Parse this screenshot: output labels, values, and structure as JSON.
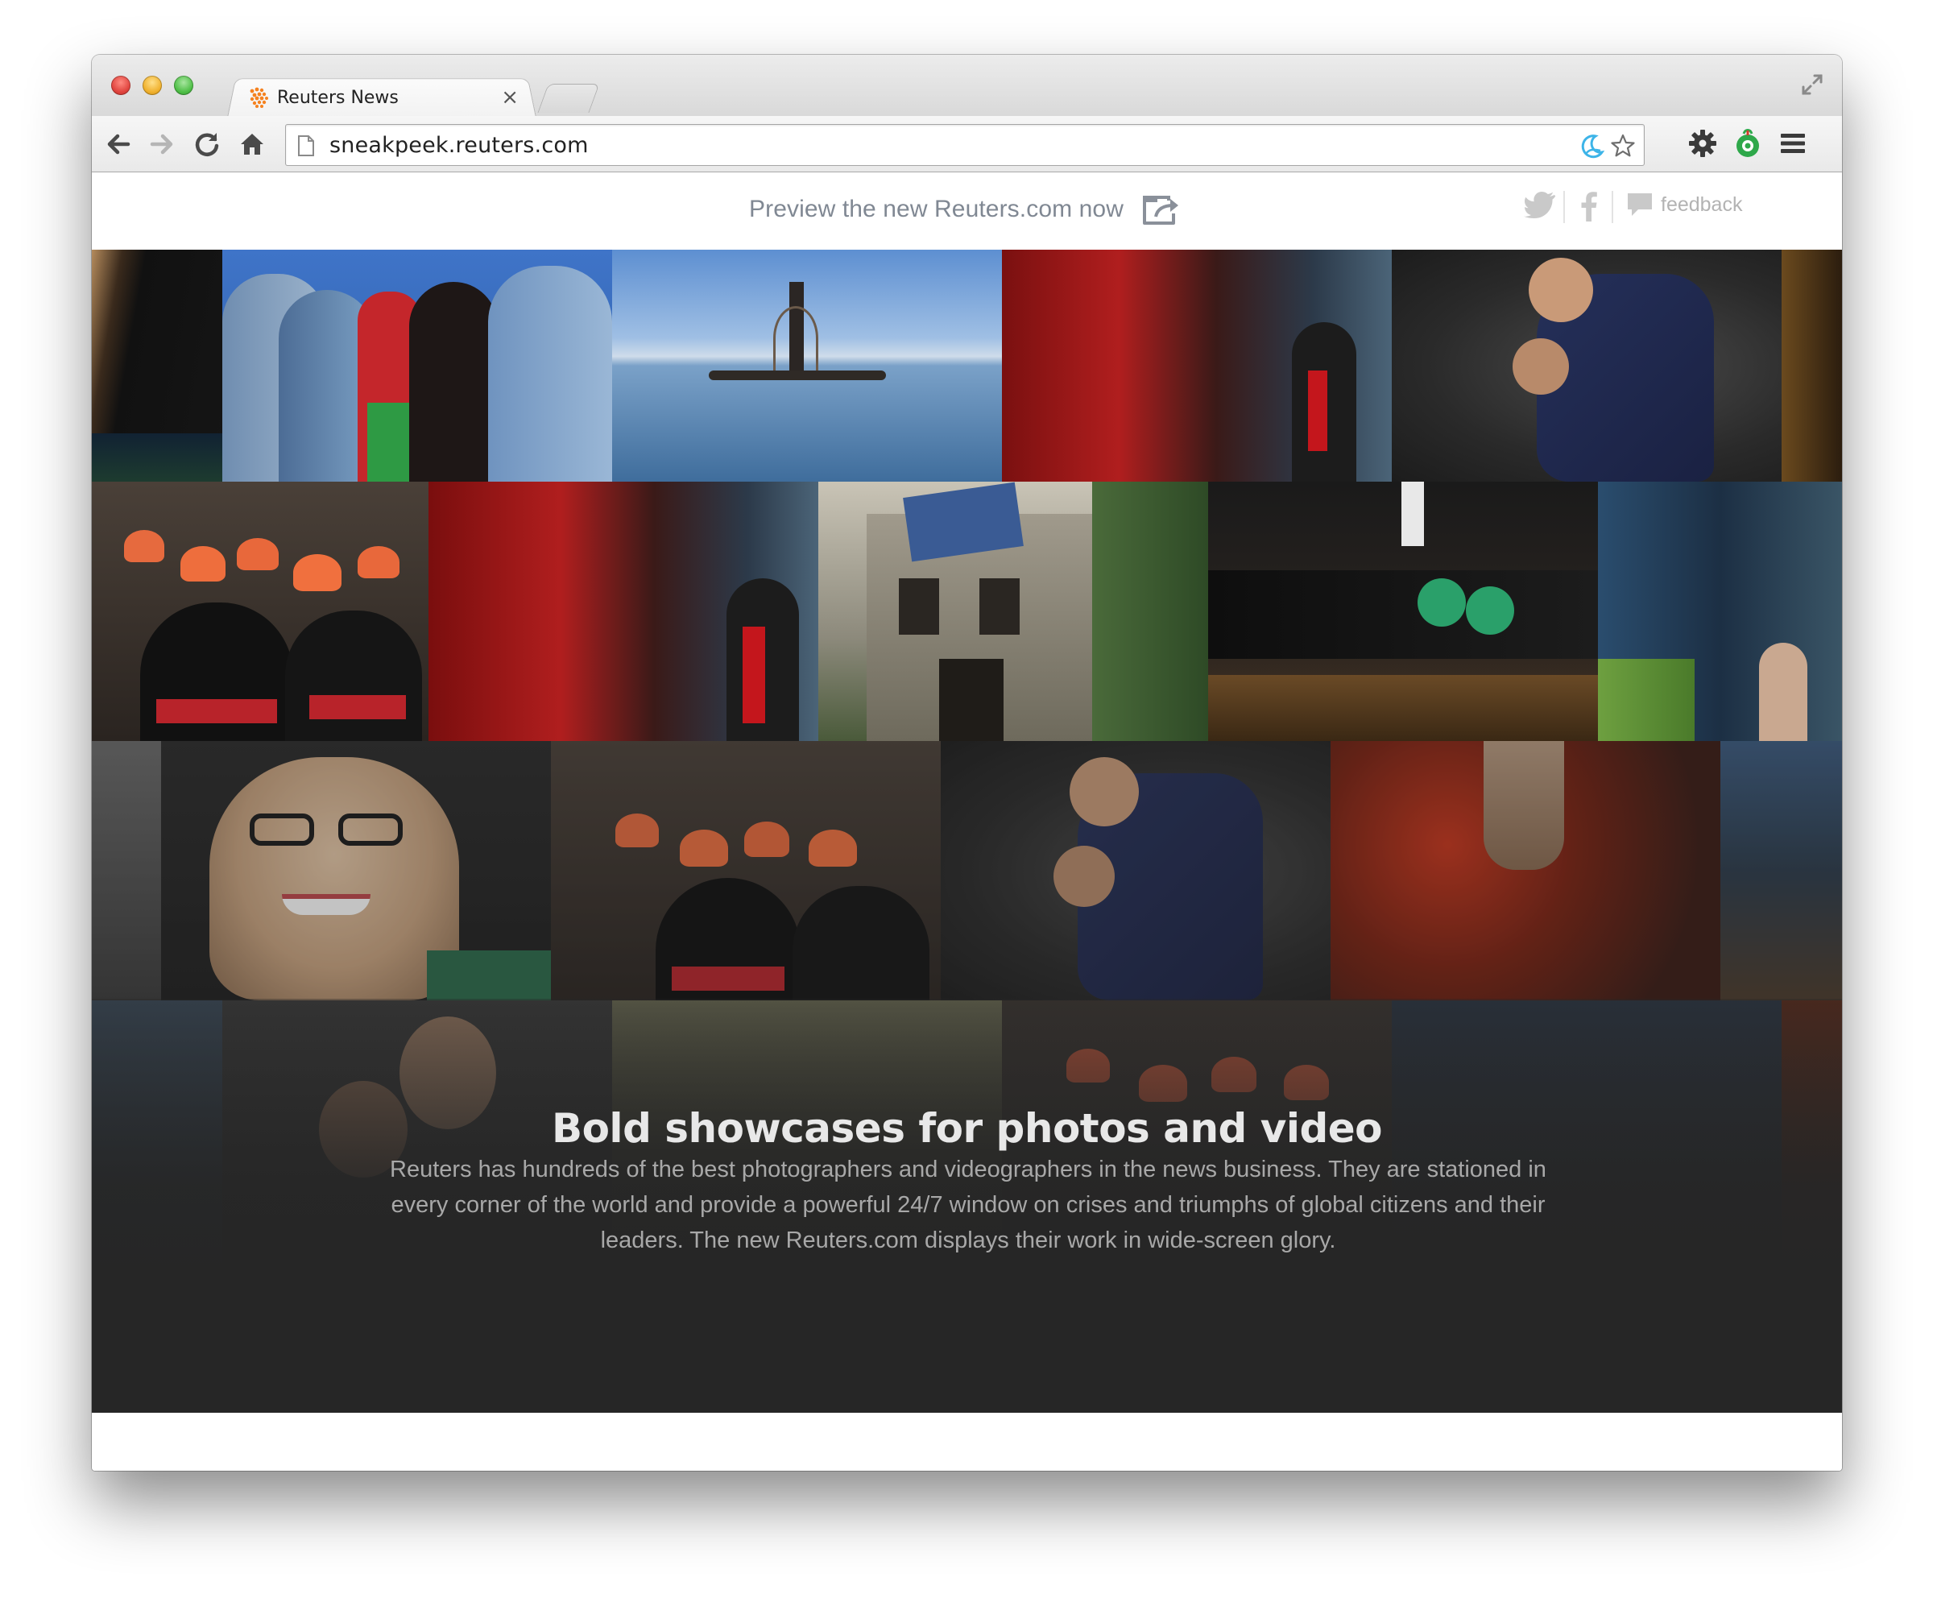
{
  "browser": {
    "tab_title": "Reuters News",
    "tab_close": "×",
    "url": "sneakpeek.reuters.com"
  },
  "promo": {
    "text": "Preview the new Reuters.com now",
    "feedback_label": "feedback"
  },
  "showcase": {
    "headline": "Bold showcases for photos and video",
    "body": "Reuters has hundreds of the best photographers and videographers in the news business. They are stationed in every corner of the world and provide a powerful 24/7 window on crises and triumphs of global citizens and their leaders. The new Reuters.com displays their work in wide-screen glory."
  },
  "colors": {
    "accent_orange": "#f58220",
    "promo_text": "#808893",
    "mosaic_bg": "#262626"
  },
  "icons": {
    "favicon": "reuters-dots-icon",
    "open_external": "open-external-icon",
    "twitter": "twitter-bird-icon",
    "facebook": "facebook-f-icon",
    "feedback": "speech-bubble-icon"
  }
}
